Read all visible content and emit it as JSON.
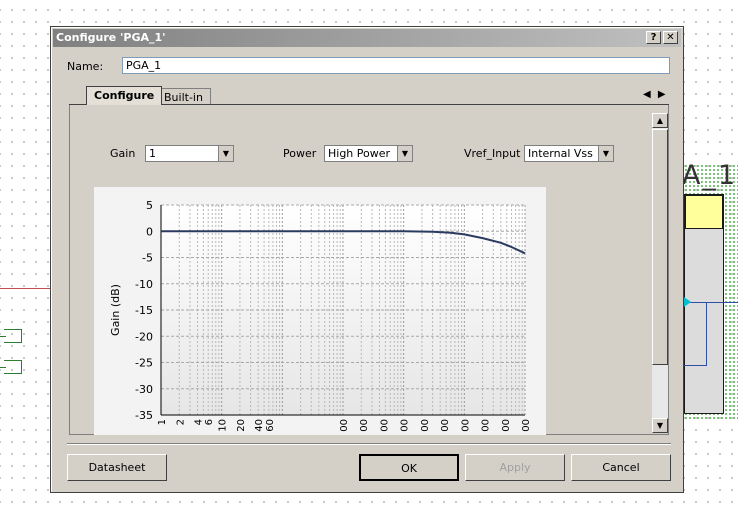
{
  "background": {
    "component_title": "A_1"
  },
  "dialog": {
    "title": "Configure 'PGA_1'",
    "help_button": "?",
    "close_button": "✕",
    "name_label": "Name:",
    "name_value": "PGA_1",
    "tabs": [
      {
        "label": "Configure",
        "active": true
      },
      {
        "label": "Built-in",
        "active": false
      }
    ],
    "tab_scroll_left": "◀",
    "tab_scroll_right": "▶",
    "params": {
      "gain_label": "Gain",
      "gain_value": "1",
      "power_label": "Power",
      "power_value": "High Power",
      "vref_label": "Vref_Input",
      "vref_value": "Internal Vss"
    },
    "buttons": {
      "datasheet": "Datasheet",
      "ok": "OK",
      "apply": "Apply",
      "cancel": "Cancel"
    }
  },
  "chart_data": {
    "type": "line",
    "title": "",
    "ylabel": "Gain (dB)",
    "xlabel": "",
    "x_scale": "log",
    "ylim": [
      -35,
      5
    ],
    "yticks": [
      5,
      0,
      -5,
      -10,
      -15,
      -20,
      -25,
      -30,
      -35
    ],
    "xtick_labels": [
      "1",
      "2",
      "4",
      "6",
      "10",
      "20",
      "40",
      "60",
      "00",
      "00",
      "00",
      "00",
      "00",
      "00",
      "00",
      "00",
      "00",
      "00"
    ],
    "grid": true,
    "line_color": "#2b3a60",
    "series": [
      {
        "name": "",
        "points": [
          [
            1,
            0
          ],
          [
            10,
            0
          ],
          [
            100,
            0
          ],
          [
            1000,
            0
          ],
          [
            10000,
            0
          ],
          [
            30000,
            -0.1
          ],
          [
            60000,
            -0.3
          ],
          [
            100000,
            -0.6
          ],
          [
            200000,
            -1.3
          ],
          [
            400000,
            -2.2
          ],
          [
            600000,
            -3.0
          ],
          [
            1000000,
            -4.2
          ]
        ]
      }
    ]
  }
}
